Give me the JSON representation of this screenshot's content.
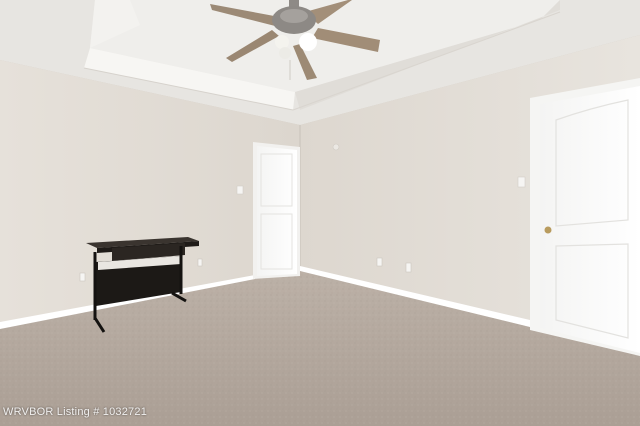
{
  "watermark": {
    "text": "WRVBOR Listing # 1032721"
  },
  "scene": {
    "description_colors": {
      "wall": "#e4dfd8",
      "ceiling": "#e9e7e3",
      "carpet": "#b6aaa0",
      "trim": "#ffffff",
      "desk": "#2a2622"
    },
    "icons": {
      "fan": "ceiling-fan-icon",
      "desk": "desk-icon",
      "door_left": "door-icon",
      "door_right": "door-icon"
    }
  }
}
